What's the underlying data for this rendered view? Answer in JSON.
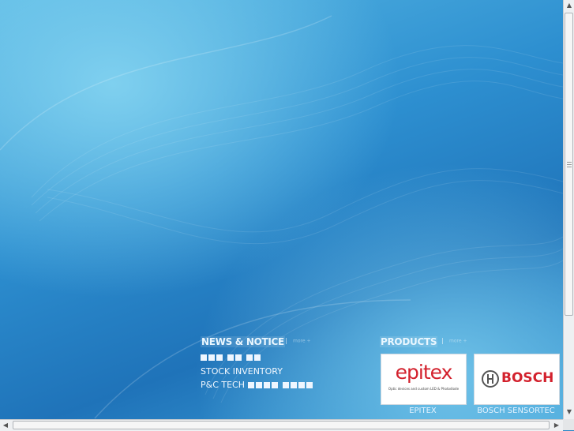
{
  "news": {
    "title": "NEWS & NOTICE",
    "more": "more +",
    "items": [
      {
        "label": ""
      },
      {
        "label": "STOCK INVENTORY"
      },
      {
        "label": "P&C TECH"
      }
    ]
  },
  "products": {
    "title": "PRODUCTS",
    "more": "more +",
    "items": [
      {
        "name": "EPITEX",
        "logo_text": "epitex",
        "tagline": "Optic devices and custom LED & Photodiode",
        "logo_color": "#d3212d"
      },
      {
        "name": "BOSCH SENSORTEC",
        "logo_text": "BOSCH",
        "logo_color": "#d3212d"
      }
    ]
  },
  "scrollbars": {
    "up_arrow": "▲",
    "down_arrow": "▼",
    "left_arrow": "◀",
    "right_arrow": "▶"
  },
  "colors": {
    "accent": "#2d8fd0",
    "text": "#f2f8ff"
  }
}
